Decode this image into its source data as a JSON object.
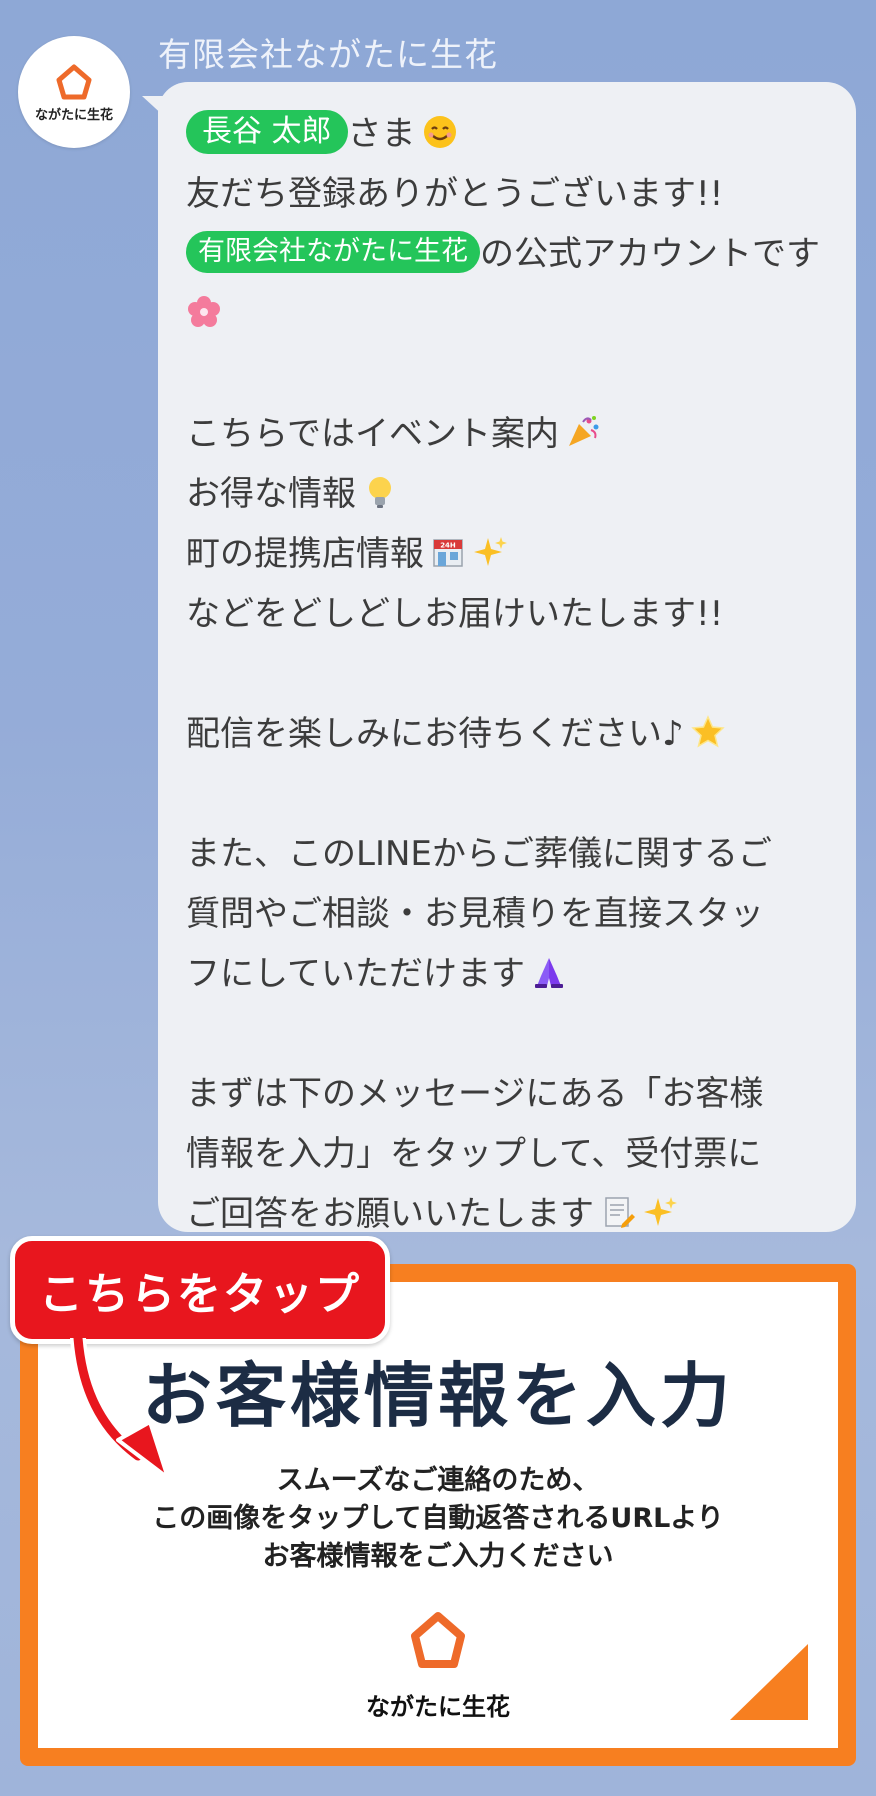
{
  "sender": {
    "name": "有限会社ながたに生花",
    "avatar_text": "ながたに生花"
  },
  "message": {
    "user_name": "長谷 太郎",
    "honorific": "さま",
    "line2": "友だち登録ありがとうございます!!",
    "company_tag": "有限会社ながたに生花",
    "line3_rest": "の公式アカウントです",
    "line5": "こちらではイベント案内",
    "line6": "お得な情報",
    "line7": "町の提携店情報",
    "line8": "などをどしどしお届けいたします!!",
    "line10": "配信を楽しみにお待ちください♪",
    "line12": "また、このLINEからご葬儀に関するご",
    "line13": "質問やご相談・お見積りを直接スタッ",
    "line14": "フにしていただけます",
    "line16": "まずは下のメッセージにある「お客様",
    "line17": "情報を入力」をタップして、受付票に",
    "line18": "ご回答をお願いいたします"
  },
  "card": {
    "title": "お客様情報を入力",
    "desc1": "スムーズなご連絡のため、",
    "desc2": "この画像をタップして自動返答されるURLより",
    "desc3": "お客様情報をご入力ください",
    "logo_text": "ながたに生花"
  },
  "tap_label": "こちらをタップ",
  "colors": {
    "accent_orange": "#f77f20",
    "tag_green": "#24c55a",
    "tap_red": "#e8161e",
    "background_blue": "#95acd8"
  }
}
